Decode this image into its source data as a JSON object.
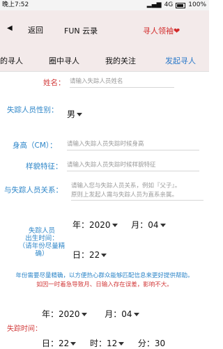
{
  "status_bar": {
    "time": "晚上7:52",
    "network": "4G",
    "battery": "100%"
  },
  "header": {
    "back_label": "返回",
    "title": "FUN 云录",
    "leader_label": "寻人领袖",
    "heart": "❤"
  },
  "tabs": [
    {
      "label": "的寻人"
    },
    {
      "label": "圈中寻人"
    },
    {
      "label": "我的关注"
    },
    {
      "label": "发起寻人"
    }
  ],
  "form": {
    "name": {
      "label": "姓名：",
      "placeholder": "请输入失踪人员姓名"
    },
    "gender": {
      "label": "失踪人员性别：",
      "value": "男"
    },
    "height": {
      "label": "身高（CM）：",
      "placeholder": "请输入失踪人员失踪时候身高"
    },
    "features": {
      "label": "样貌特征：",
      "placeholder": "请输入失踪人员失踪时候样貌特征"
    },
    "relation": {
      "label": "与失踪人员关系：",
      "placeholder_line1": "请输入您与失踪人员关系，例如『父子』。",
      "placeholder_line2": "原则上发起人需与失踪人员为直系亲属。"
    },
    "birth": {
      "label_line1": "失踪人员",
      "label_line2": "出生时间：",
      "label_line3": "（请年份尽量精确）",
      "year_label": "年：",
      "year_value": "2020",
      "month_label": "月：",
      "month_value": "04",
      "day_label": "日：",
      "day_value": "22"
    },
    "note_blue_line1": "年份需要尽量精确，以方便热心群众能够匹配信息来更好提供帮助。",
    "note_red_line1": "如因一时着急导致月、日输入存在误差，影响不大。",
    "missing_time": {
      "year_label": "年：",
      "year_value": "2020",
      "month_label": "月：",
      "month_value": "04",
      "label": "失踪时间：",
      "day_label": "日：",
      "day_value": "22",
      "hour_label": "时：",
      "hour_value": "12",
      "minute_label": "分：",
      "minute_value": "30"
    }
  }
}
